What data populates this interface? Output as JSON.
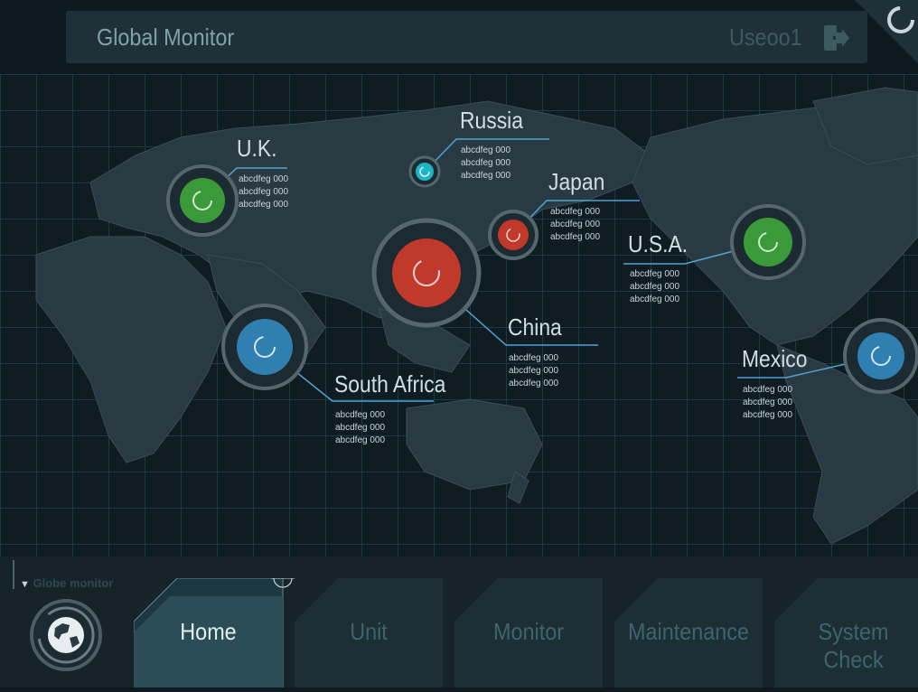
{
  "header": {
    "title": "Global Monitor",
    "user": "Useoo1"
  },
  "markers": [
    {
      "name": "U.K.",
      "lines": [
        "abcdfeg 000",
        "abcdfeg 000",
        "abcdfeg 000"
      ],
      "color": "#3a9a3a"
    },
    {
      "name": "Russia",
      "lines": [
        "abcdfeg 000",
        "abcdfeg 000",
        "abcdfeg 000"
      ],
      "color": "#1fb4c4"
    },
    {
      "name": "Japan",
      "lines": [
        "abcdfeg 000",
        "abcdfeg 000",
        "abcdfeg 000"
      ],
      "color": "#c0392b"
    },
    {
      "name": "U.S.A.",
      "lines": [
        "abcdfeg 000",
        "abcdfeg 000",
        "abcdfeg 000"
      ],
      "color": "#3a9a3a"
    },
    {
      "name": "China",
      "lines": [
        "abcdfeg 000",
        "abcdfeg 000",
        "abcdfeg 000"
      ],
      "color": "#c0392b"
    },
    {
      "name": "South Africa",
      "lines": [
        "abcdfeg 000",
        "abcdfeg 000",
        "abcdfeg 000"
      ],
      "color": "#2f7fb0"
    },
    {
      "name": "Mexico",
      "lines": [
        "abcdfeg 000",
        "abcdfeg 000",
        "abcdfeg 000"
      ],
      "color": "#2f7fb0"
    }
  ],
  "footer": {
    "globe_label": "Globe monitor",
    "tabs": [
      "Home",
      "Unit",
      "Monitor",
      "Maintenance",
      "System Check"
    ],
    "active_tab": "Home"
  }
}
